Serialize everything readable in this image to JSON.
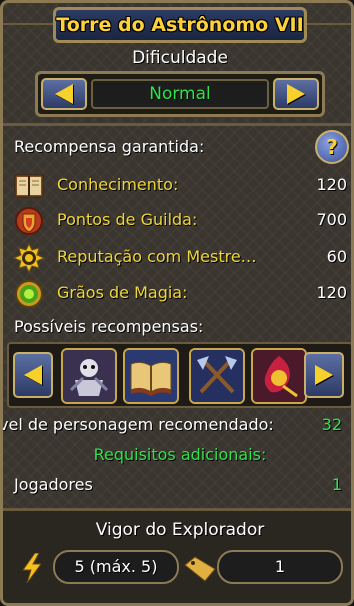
{
  "window": {
    "title": "Torre do Astrônomo VII"
  },
  "difficulty": {
    "label": "Dificuldade",
    "value": "Normal",
    "value_color": "#2fe34a"
  },
  "guaranteed": {
    "title": "Recompensa garantida:",
    "help_symbol": "?",
    "items": [
      {
        "name": "Conhecimento:",
        "value": "120",
        "icon": "book-icon"
      },
      {
        "name": "Pontos de Guilda:",
        "value": "700",
        "icon": "guild-shield-icon"
      },
      {
        "name": "Reputação com Mestre…",
        "value": "60",
        "icon": "reputation-badge-icon"
      },
      {
        "name": "Grãos de Magia:",
        "value": "120",
        "icon": "magic-grain-icon"
      }
    ]
  },
  "possible": {
    "title": "Possíveis recompensas:",
    "items": [
      {
        "icon": "skeleton-crest-icon"
      },
      {
        "icon": "spellbook-icon"
      },
      {
        "icon": "crossed-axes-icon"
      },
      {
        "icon": "phoenix-rune-icon"
      }
    ]
  },
  "level": {
    "label": "vel de personagem recomendado:",
    "value": "32"
  },
  "requirements": {
    "title": "Requisitos adicionais:",
    "players_label": "Jogadores",
    "players_value": "1"
  },
  "vigor": {
    "title": "Vigor do Explorador",
    "energy_value": "5 (máx. 5)",
    "ticket_value": "1"
  },
  "colors": {
    "gold": "#f0d63a",
    "green": "#2fe34a",
    "frame": "#8c7a54"
  }
}
